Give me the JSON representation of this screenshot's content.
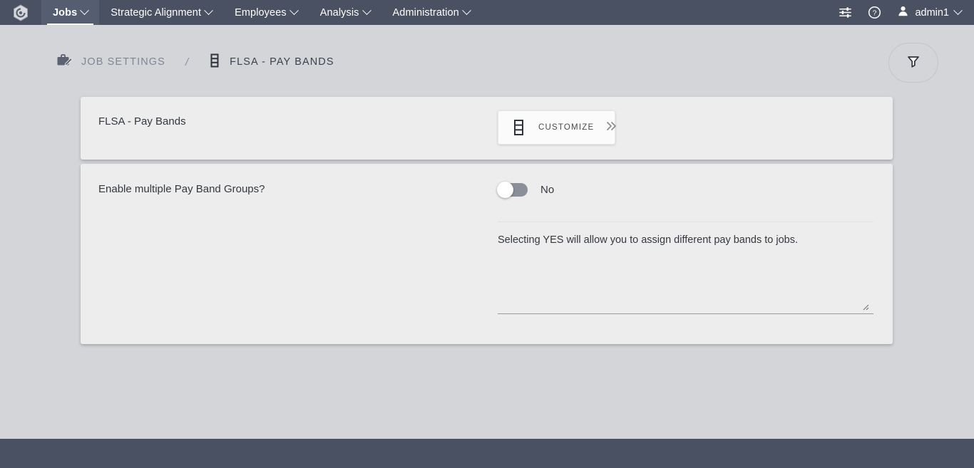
{
  "topbar": {
    "logo_icon": "hexagon-logo-icon",
    "nav": [
      {
        "label": "Jobs",
        "active": true,
        "icon": "chevron-down-icon"
      },
      {
        "label": "Strategic Alignment",
        "active": false,
        "icon": "chevron-down-icon"
      },
      {
        "label": "Employees",
        "active": false,
        "icon": "chevron-down-icon"
      },
      {
        "label": "Analysis",
        "active": false,
        "icon": "chevron-down-icon"
      },
      {
        "label": "Administration",
        "active": false,
        "icon": "chevron-down-icon"
      }
    ],
    "settings_icon": "sliders-icon",
    "help_icon": "help-circle-icon",
    "user_icon": "user-avatar-icon",
    "user_name": "admin1",
    "user_caret_icon": "chevron-down-icon",
    "background_color": "#4a5163"
  },
  "breadcrumb": {
    "parent": {
      "label": "JOB SETTINGS",
      "icon": "briefcase-edit-icon"
    },
    "separator": "/",
    "current": {
      "label": "FLSA - PAY BANDS",
      "icon": "pay-bands-icon"
    }
  },
  "filter_button": {
    "icon": "filter-funnel-icon"
  },
  "title_card": {
    "heading": "FLSA - Pay Bands",
    "customize_button": {
      "label": "CUSTOMIZE",
      "icon": "pay-bands-icon",
      "chevron": "»"
    }
  },
  "settings_card": {
    "toggle": {
      "label": "Enable multiple Pay Band Groups?",
      "value": "No",
      "state": "off"
    },
    "description": {
      "value": "Selecting YES will allow you to assign different pay bands to jobs.",
      "placeholder": ""
    }
  },
  "theme": {
    "page_background": "#d3d5d8",
    "card_background": "#ededed",
    "nav_background": "#4a5163",
    "text_primary": "#34383f",
    "text_muted": "#808694"
  }
}
